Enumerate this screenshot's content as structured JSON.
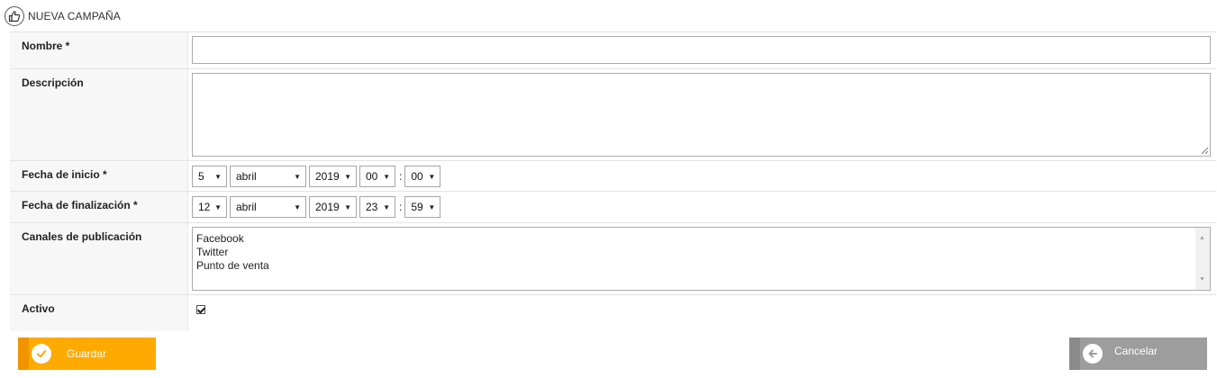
{
  "header": {
    "title": "NUEVA CAMPAÑA",
    "icon": "thumbs-up-icon"
  },
  "form": {
    "nombre": {
      "label": "Nombre *",
      "value": ""
    },
    "descripcion": {
      "label": "Descripción",
      "value": ""
    },
    "fecha_inicio": {
      "label": "Fecha de inicio *",
      "day": "5",
      "month": "abril",
      "year": "2019",
      "hour": "00",
      "minute": "00"
    },
    "fecha_fin": {
      "label": "Fecha de finalización *",
      "day": "12",
      "month": "abril",
      "year": "2019",
      "hour": "23",
      "minute": "59"
    },
    "canales": {
      "label": "Canales de publicación",
      "options": [
        "Facebook",
        "Twitter",
        "Punto de venta"
      ]
    },
    "activo": {
      "label": "Activo",
      "checked": true
    },
    "time_separator": ":"
  },
  "buttons": {
    "save": {
      "label": "Guardar",
      "icon": "checkmark-icon",
      "color": "#ffaa00"
    },
    "cancel": {
      "label": "Cancelar",
      "icon": "arrow-left-icon",
      "color": "#9d9d9d"
    }
  }
}
